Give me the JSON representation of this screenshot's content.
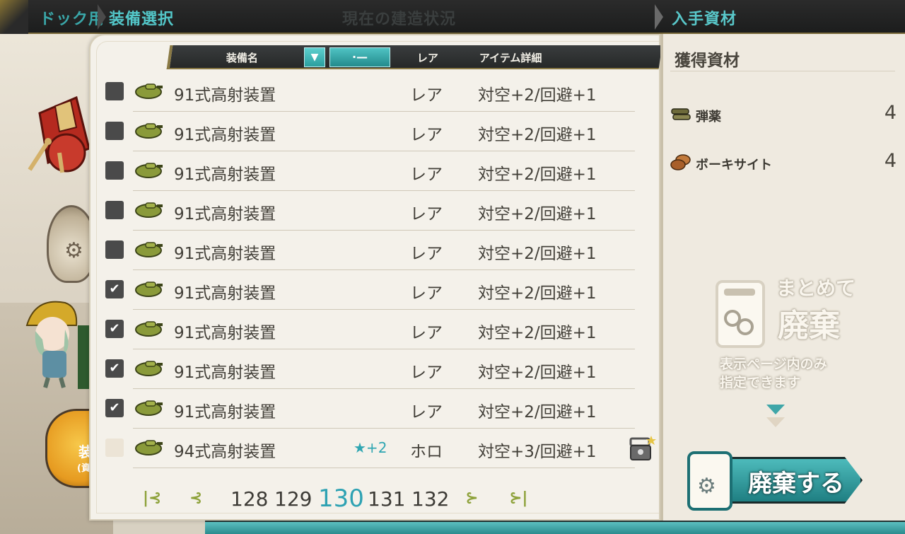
{
  "header": {
    "dock_label": "ドック用",
    "select_label": "装備選択",
    "status_label": "現在の建造状況",
    "acquired_label": "入手資材"
  },
  "list": {
    "columns": {
      "name": "装備名",
      "sort_icon": "▼",
      "filter_label": "·—",
      "rarity": "レア",
      "detail": "アイテム詳細"
    },
    "rows": [
      {
        "checked": false,
        "disabled": false,
        "name": "91式高射装置",
        "star": "",
        "rarity": "レア",
        "detail": "対空+2/回避+1",
        "locked": false
      },
      {
        "checked": false,
        "disabled": false,
        "name": "91式高射装置",
        "star": "",
        "rarity": "レア",
        "detail": "対空+2/回避+1",
        "locked": false
      },
      {
        "checked": false,
        "disabled": false,
        "name": "91式高射装置",
        "star": "",
        "rarity": "レア",
        "detail": "対空+2/回避+1",
        "locked": false
      },
      {
        "checked": false,
        "disabled": false,
        "name": "91式高射装置",
        "star": "",
        "rarity": "レア",
        "detail": "対空+2/回避+1",
        "locked": false
      },
      {
        "checked": false,
        "disabled": false,
        "name": "91式高射装置",
        "star": "",
        "rarity": "レア",
        "detail": "対空+2/回避+1",
        "locked": false
      },
      {
        "checked": true,
        "disabled": false,
        "name": "91式高射装置",
        "star": "",
        "rarity": "レア",
        "detail": "対空+2/回避+1",
        "locked": false
      },
      {
        "checked": true,
        "disabled": false,
        "name": "91式高射装置",
        "star": "",
        "rarity": "レア",
        "detail": "対空+2/回避+1",
        "locked": false
      },
      {
        "checked": true,
        "disabled": false,
        "name": "91式高射装置",
        "star": "",
        "rarity": "レア",
        "detail": "対空+2/回避+1",
        "locked": false
      },
      {
        "checked": true,
        "disabled": false,
        "name": "91式高射装置",
        "star": "",
        "rarity": "レア",
        "detail": "対空+2/回避+1",
        "locked": false
      },
      {
        "checked": false,
        "disabled": true,
        "name": "94式高射装置",
        "star": "★+2",
        "rarity": "ホロ",
        "detail": "対空+3/回避+1",
        "locked": true
      }
    ],
    "pager": {
      "first": "|⊰",
      "prev": "⊰",
      "pages": [
        "128",
        "129",
        "130",
        "131",
        "132"
      ],
      "current": "130",
      "next": "⊱",
      "last": "⊱|"
    }
  },
  "acquired": {
    "title": "獲得資材",
    "resources": [
      {
        "name": "弾薬",
        "count": "4",
        "icon": "ammo-icon"
      },
      {
        "name": "ボーキサイト",
        "count": "4",
        "icon": "bauxite-icon"
      }
    ],
    "bulk": {
      "line1": "まとめて",
      "line2": "廃棄",
      "line3": "表示ページ内のみ",
      "line4": "指定できます"
    },
    "scrap_button": "廃棄する"
  },
  "left": {
    "hex_line1": "装",
    "hex_line2": "(資"
  },
  "colors": {
    "accent_teal": "#3aa7a9",
    "current_page": "#2ea2b3",
    "checkbox": "#4a4a4a",
    "pager_ornament": "#8ea23b"
  }
}
